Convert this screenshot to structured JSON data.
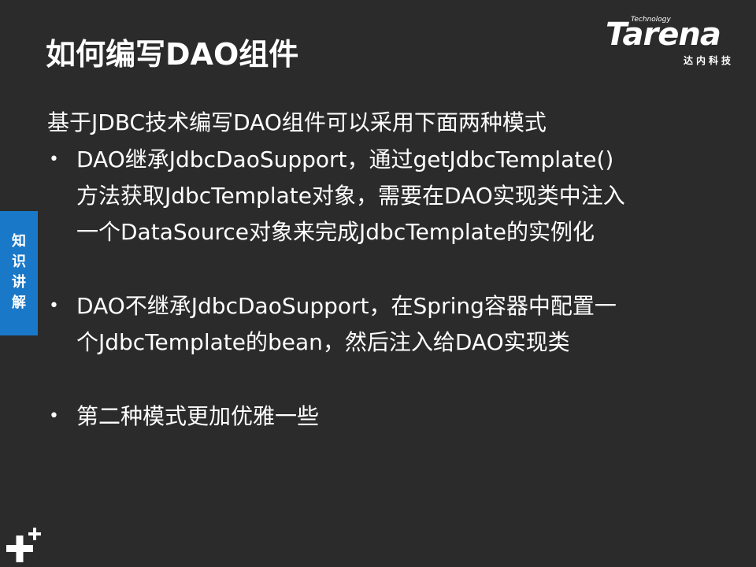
{
  "slide": {
    "title": "如何编写DAO组件",
    "side_tab_label": "知识讲解",
    "intro": "基于JDBC技术编写DAO组件可以采用下面两种模式",
    "bullets": [
      {
        "line1": "DAO继承JdbcDaoSupport，通过getJdbcTemplate()",
        "line2": "方法获取JdbcTemplate对象，需要在DAO实现类中注入",
        "line3": "一个DataSource对象来完成JdbcTemplate的实例化"
      },
      {
        "line1": "DAO不继承JdbcDaoSupport，在Spring容器中配置一",
        "line2": "个JdbcTemplate的bean，然后注入给DAO实现类"
      },
      {
        "line1": "第二种模式更加优雅一些"
      }
    ],
    "bullet_symbol": "•"
  },
  "logo": {
    "tagline": "Technology",
    "wordmark": "Tarena",
    "chinese": "达内科技"
  },
  "icons": {
    "corner": "plus-plus-icon"
  },
  "colors": {
    "background": "#2b2b2b",
    "text": "#ffffff",
    "side_tab": "#1a78c8"
  }
}
